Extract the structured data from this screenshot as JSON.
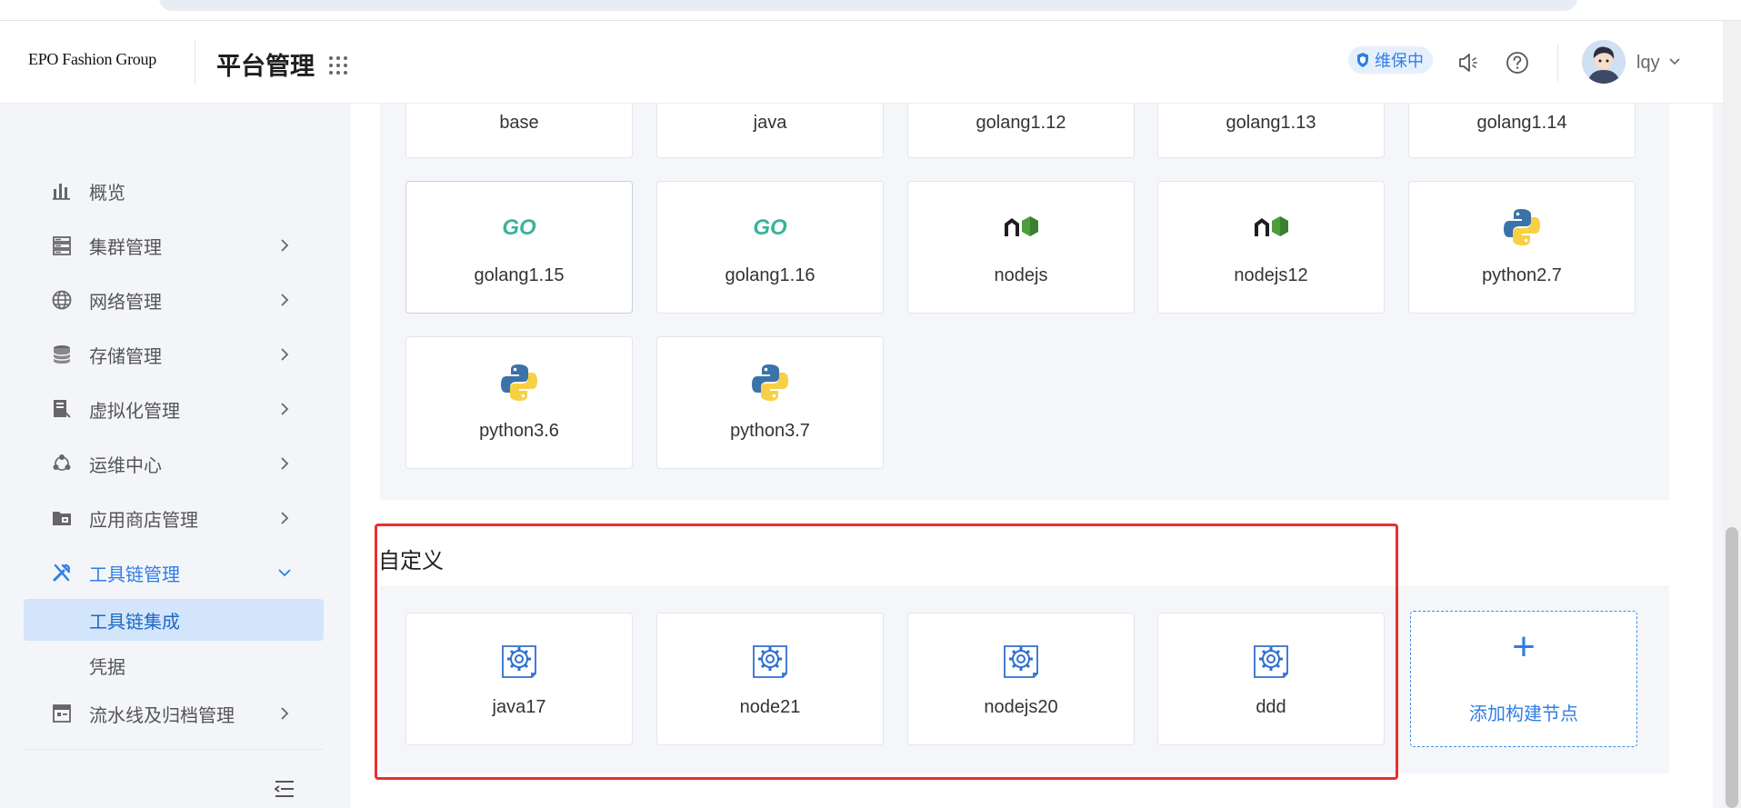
{
  "header": {
    "logo": "EPO Fashion Group",
    "title": "平台管理",
    "maintenance_badge": "维保中",
    "username": "lqy"
  },
  "sidebar": {
    "items": [
      {
        "label": "概览",
        "icon": "bar-chart-icon"
      },
      {
        "label": "集群管理",
        "icon": "server-icon"
      },
      {
        "label": "网络管理",
        "icon": "globe-icon"
      },
      {
        "label": "存储管理",
        "icon": "database-icon"
      },
      {
        "label": "虚拟化管理",
        "icon": "virtual-icon"
      },
      {
        "label": "运维中心",
        "icon": "ops-icon"
      },
      {
        "label": "应用商店管理",
        "icon": "store-icon"
      },
      {
        "label": "工具链管理",
        "icon": "tools-icon"
      },
      {
        "label": "流水线及归档管理",
        "icon": "pipeline-icon"
      }
    ],
    "subitems": [
      {
        "label": "工具链集成",
        "selected": true
      },
      {
        "label": "凭据",
        "selected": false
      }
    ]
  },
  "builtin_cards": [
    {
      "label": "base",
      "icon": "none"
    },
    {
      "label": "java",
      "icon": "none"
    },
    {
      "label": "golang1.12",
      "icon": "none"
    },
    {
      "label": "golang1.13",
      "icon": "none"
    },
    {
      "label": "golang1.14",
      "icon": "none"
    },
    {
      "label": "golang1.15",
      "icon": "go-logo-icon"
    },
    {
      "label": "golang1.16",
      "icon": "go-logo-icon"
    },
    {
      "label": "nodejs",
      "icon": "nodejs-logo-icon"
    },
    {
      "label": "nodejs12",
      "icon": "nodejs-logo-icon"
    },
    {
      "label": "python2.7",
      "icon": "python-logo-icon"
    },
    {
      "label": "python3.6",
      "icon": "python-logo-icon"
    },
    {
      "label": "python3.7",
      "icon": "python-logo-icon"
    }
  ],
  "custom_section": {
    "title": "自定义",
    "cards": [
      {
        "label": "java17",
        "icon": "gear-document-icon"
      },
      {
        "label": "node21",
        "icon": "gear-document-icon"
      },
      {
        "label": "nodejs20",
        "icon": "gear-document-icon"
      },
      {
        "label": "ddd",
        "icon": "gear-document-icon"
      }
    ],
    "add_button": {
      "symbol": "+",
      "label": "添加构建节点"
    }
  },
  "colors": {
    "accent": "#2f7fe4",
    "highlight_box": "#e8302a",
    "selected_bg": "#d2e5fb"
  }
}
